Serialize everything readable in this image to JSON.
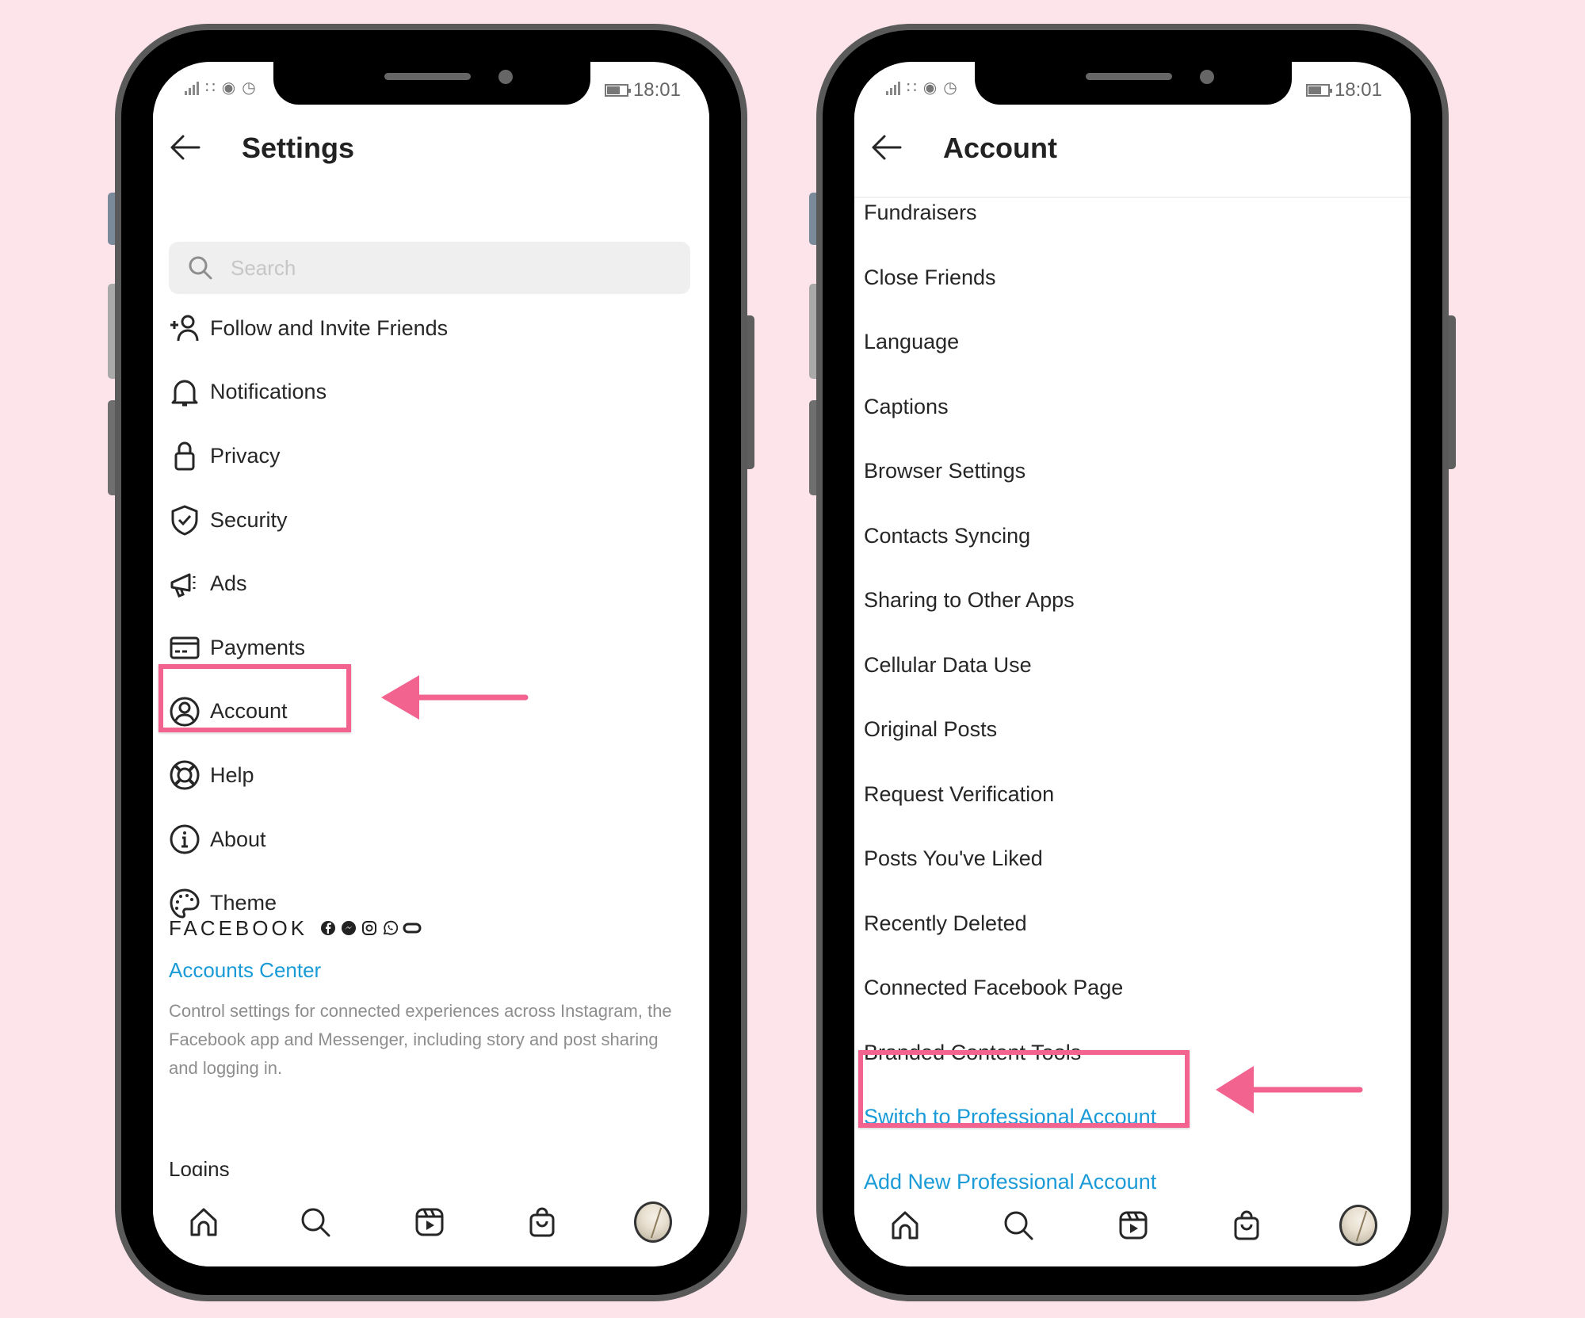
{
  "background_color": "#fde4ea",
  "annotation_color": "#f2648f",
  "link_color": "#1a9bd7",
  "status_bar": {
    "time": "18:01"
  },
  "left_phone": {
    "header": {
      "title": "Settings",
      "back_icon": "arrow-left-icon"
    },
    "search": {
      "placeholder": "Search",
      "value": "",
      "icon": "search-icon"
    },
    "menu": [
      {
        "label": "Follow and Invite Friends",
        "icon": "add-person-icon"
      },
      {
        "label": "Notifications",
        "icon": "bell-icon"
      },
      {
        "label": "Privacy",
        "icon": "lock-icon"
      },
      {
        "label": "Security",
        "icon": "shield-check-icon"
      },
      {
        "label": "Ads",
        "icon": "megaphone-icon"
      },
      {
        "label": "Payments",
        "icon": "credit-card-icon"
      },
      {
        "label": "Account",
        "icon": "user-circle-icon",
        "highlighted": true
      },
      {
        "label": "Help",
        "icon": "lifebuoy-icon"
      },
      {
        "label": "About",
        "icon": "info-icon"
      },
      {
        "label": "Theme",
        "icon": "palette-icon"
      }
    ],
    "facebook": {
      "title": "FACEBOOK",
      "icons": [
        "facebook-icon",
        "messenger-icon",
        "instagram-icon",
        "whatsapp-icon",
        "oculus-icon"
      ],
      "accounts_center": "Accounts Center",
      "description": "Control settings for connected experiences across Instagram, the Facebook app and Messenger, including story and post sharing and logging in."
    },
    "logins_label": "Logins",
    "bottom_nav": [
      "home-icon",
      "search-icon",
      "reels-icon",
      "shop-icon",
      "profile-avatar"
    ]
  },
  "right_phone": {
    "header": {
      "title": "Account",
      "back_icon": "arrow-left-icon"
    },
    "items": [
      {
        "label": "Fundraisers"
      },
      {
        "label": "Close Friends"
      },
      {
        "label": "Language"
      },
      {
        "label": "Captions"
      },
      {
        "label": "Browser Settings"
      },
      {
        "label": "Contacts Syncing"
      },
      {
        "label": "Sharing to Other Apps"
      },
      {
        "label": "Cellular Data Use"
      },
      {
        "label": "Original Posts"
      },
      {
        "label": "Request Verification"
      },
      {
        "label": "Posts You've Liked"
      },
      {
        "label": "Recently Deleted"
      },
      {
        "label": "Connected Facebook Page"
      },
      {
        "label": "Branded Content Tools"
      },
      {
        "label": "Switch to Professional Account",
        "link": true,
        "highlighted": true
      },
      {
        "label": "Add New Professional Account",
        "link": true
      }
    ],
    "bottom_nav": [
      "home-icon",
      "search-icon",
      "reels-icon",
      "shop-icon",
      "profile-avatar"
    ]
  }
}
